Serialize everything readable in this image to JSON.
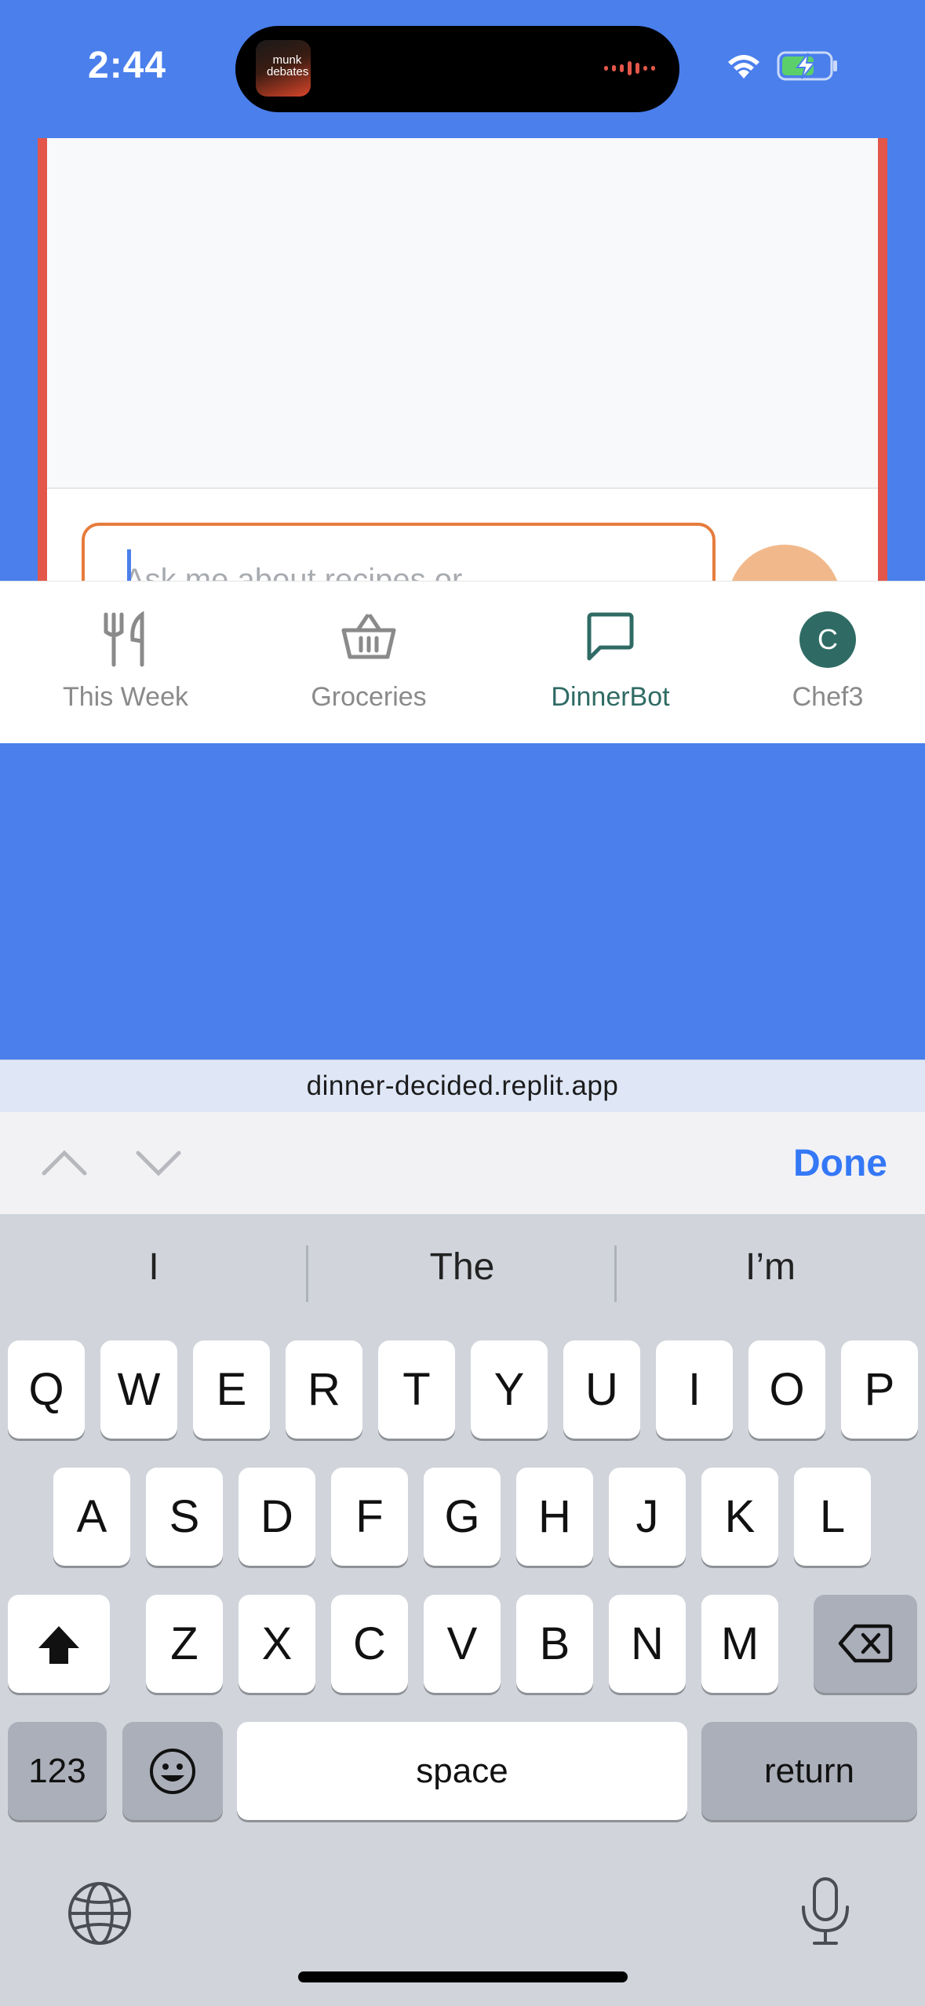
{
  "status": {
    "time": "2:44",
    "live_activity_art_text": "munk debates"
  },
  "chat": {
    "input_placeholder": "Ask me about recipes or"
  },
  "nav": [
    {
      "label": "This Week",
      "icon": "fork-knife-icon",
      "active": false
    },
    {
      "label": "Groceries",
      "icon": "basket-icon",
      "active": false
    },
    {
      "label": "DinnerBot",
      "icon": "chat-bubble-icon",
      "active": true
    },
    {
      "label": "Chef3",
      "icon": "avatar",
      "avatar_letter": "C",
      "active": false
    }
  ],
  "browser": {
    "url": "dinner-decided.replit.app",
    "done_label": "Done"
  },
  "keyboard": {
    "suggestions": [
      "I",
      "The",
      "I’m"
    ],
    "row1": [
      "Q",
      "W",
      "E",
      "R",
      "T",
      "Y",
      "U",
      "I",
      "O",
      "P"
    ],
    "row2": [
      "A",
      "S",
      "D",
      "F",
      "G",
      "H",
      "J",
      "K",
      "L"
    ],
    "row3": [
      "Z",
      "X",
      "C",
      "V",
      "B",
      "N",
      "M"
    ],
    "numbers_label": "123",
    "space_label": "space",
    "return_label": "return"
  },
  "colors": {
    "background": "#4a7fec",
    "card_border": "#e2574a",
    "input_border": "#e67c3d",
    "send_button": "#f1b98b",
    "nav_active": "#2f6b64",
    "done_blue": "#3478f6"
  }
}
